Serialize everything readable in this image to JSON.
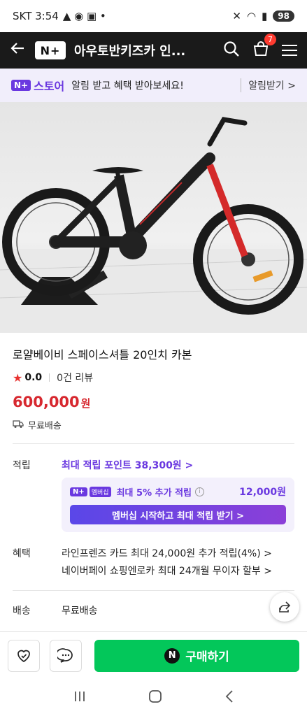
{
  "status_bar": {
    "carrier_time": "SKT 3:54",
    "battery": "98"
  },
  "header": {
    "logo": "N+",
    "title": "아우토반키즈카 인...",
    "cart_count": "7"
  },
  "store_banner": {
    "logo": "N+",
    "store_name": "스토어",
    "message": "알림 받고 혜택 받아보세요!",
    "alarm_button": "알림받기 >"
  },
  "product": {
    "title": "로얄베이비 스페이스셔틀 20인치 카본",
    "rating": "0.0",
    "reviews": "0건 리뷰",
    "price": "600,000",
    "price_unit": "원",
    "shipping_badge": "무료배송"
  },
  "points": {
    "label": "적립",
    "link": "최대 적립 포인트 38,300원 >",
    "membership": {
      "tag1": "N+",
      "tag2": "멤버십",
      "text": "최대 5% 추가 적립",
      "amount": "12,000원",
      "button": "멤버십 시작하고 최대 적립 받기 >"
    }
  },
  "benefits": {
    "label": "혜택",
    "lines": [
      "라인프렌즈 카드 최대 24,000원 추가 적립(4%) >",
      "네이버페이 쇼핑엔로카 최대 24개월 무이자 할부 >"
    ]
  },
  "delivery": {
    "label": "배송",
    "value": "무료배송"
  },
  "actions": {
    "buy_label": "구매하기",
    "buy_icon": "N"
  },
  "colors": {
    "accent": "#6a38e0",
    "price": "#d7282f",
    "buy": "#03c75a"
  }
}
